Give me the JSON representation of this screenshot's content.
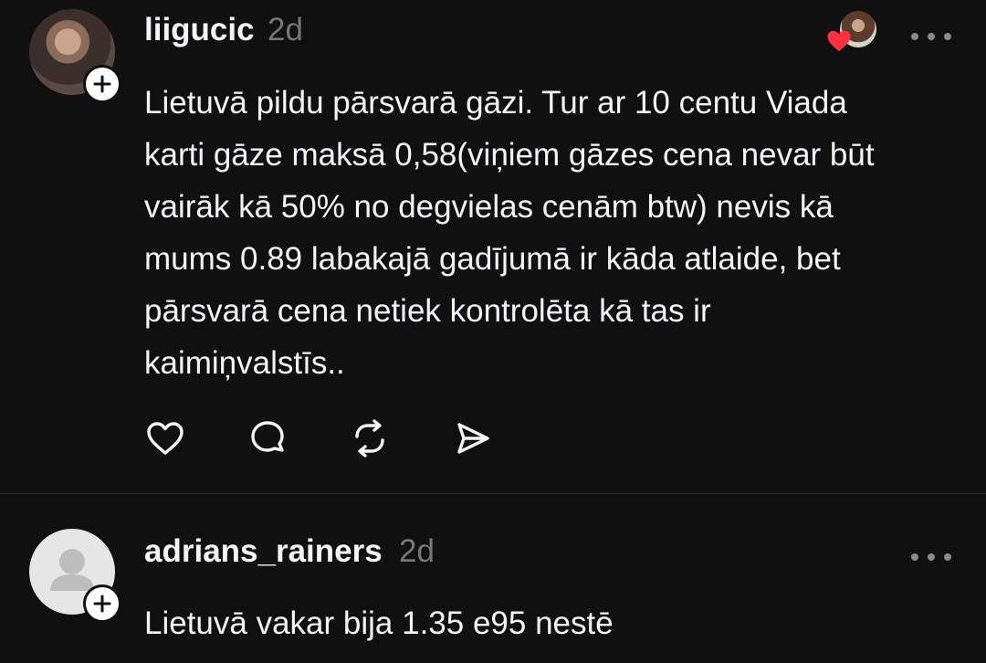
{
  "posts": [
    {
      "username": "liigucic",
      "time": "2d",
      "text_lines": [
        "Lietuvā pildu pārsvarā gāzi. Tur ar 10 centu Viada",
        "karti gāze maksā 0,58(viņiem gāzes cena nevar būt",
        "vairāk kā 50% no degvielas cenām btw) nevis kā",
        "mums 0.89 labakajā gadījumā ir kāda atlaide, bet",
        "pārsvarā cena netiek kontrolēta kā tas ir",
        "kaimiņvalstīs.."
      ],
      "avatar_icon": "user-photo",
      "liked_by_icon": "liker-avatar-heart"
    },
    {
      "username": "adrians_rainers",
      "time": "2d",
      "text_lines": [
        "Lietuvā vakar bija 1.35 e95 nestē"
      ],
      "avatar_icon": "default-avatar-icon"
    }
  ],
  "actions": [
    "heart-icon",
    "comment-icon",
    "repost-icon",
    "share-icon"
  ],
  "colors": {
    "background": "#101010",
    "text": "#f3f5f7",
    "muted": "#777777",
    "heart": "#ff3040"
  }
}
